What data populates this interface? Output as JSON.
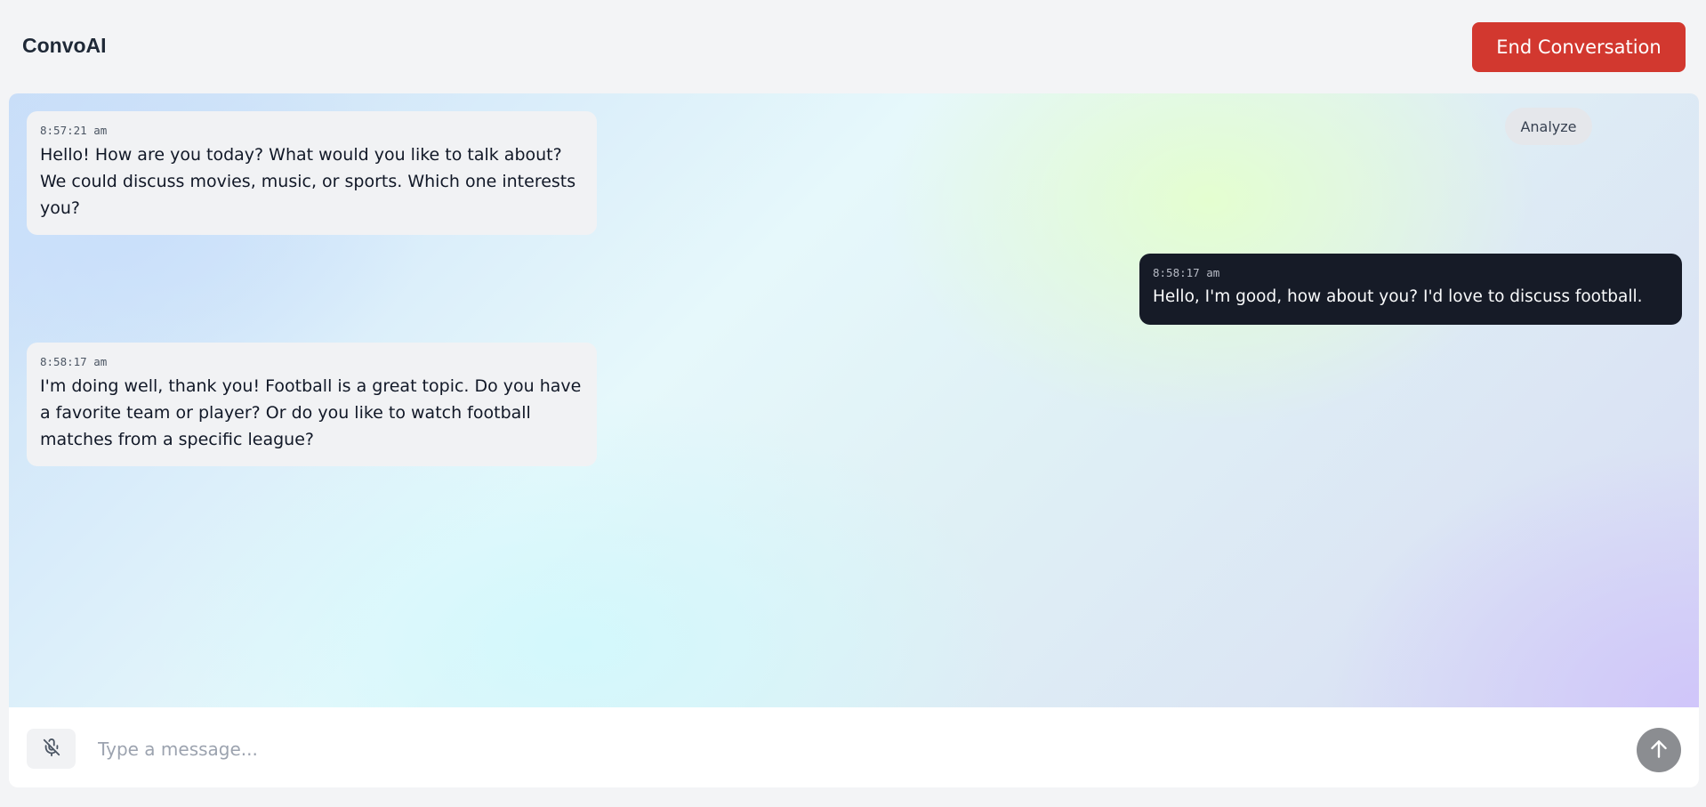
{
  "header": {
    "brand": "ConvoAI",
    "end_button_label": "End Conversation"
  },
  "chat": {
    "analyze_label": "Analyze",
    "messages": [
      {
        "role": "assistant",
        "timestamp": "8:57:21 am",
        "text": "Hello! How are you today? What would you like to talk about? We could discuss movies, music, or sports. Which one interests you?"
      },
      {
        "role": "user",
        "timestamp": "8:58:17 am",
        "text": "Hello, I'm good, how about you? I'd love to discuss football."
      },
      {
        "role": "assistant",
        "timestamp": "8:58:17 am",
        "text": "I'm doing well, thank you! Football is a great topic. Do you have a favorite team or player? Or do you like to watch football matches from a specific league?"
      }
    ]
  },
  "input": {
    "placeholder": "Type a message...",
    "value": "",
    "mic_icon": "mic-off-icon",
    "send_icon": "arrow-up-icon"
  },
  "colors": {
    "end_button": "#d2382f",
    "user_bubble": "#161b27",
    "assistant_bubble": "#f1f2f4",
    "send_button": "#8b8d91"
  }
}
